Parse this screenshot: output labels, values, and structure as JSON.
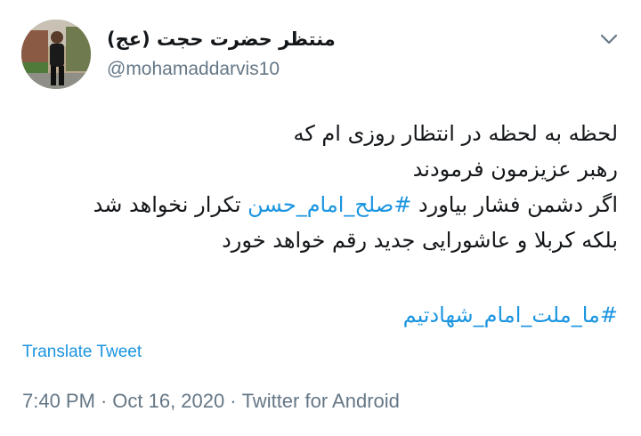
{
  "tweet": {
    "display_name": "منتظر حضرت حجت (عج)",
    "handle": "@mohamaddarvis10",
    "body_lines": [
      "لحظه به لحظه در انتظار روزی ام که",
      "رهبر عزیزمون فرمودند"
    ],
    "line3_before": "اگر دشمن فشار بیاورد ",
    "line3_hashtag": "#صلح_امام_حسن",
    "line3_after": " تکرار نخواهد شد",
    "line4": "بلکه کربلا و عاشورایی جدید رقم خواهد خورد",
    "hashtag_line": "#ما_ملت_امام_شهادتیم",
    "translate_label": "Translate Tweet",
    "time": "7:40 PM",
    "date": "Oct 16, 2020",
    "source": "Twitter for Android",
    "separator": "·"
  },
  "colors": {
    "link": "#1b95e0",
    "secondary": "#657786",
    "text": "#14171a"
  },
  "icons": {
    "menu": "chevron-down-icon"
  }
}
